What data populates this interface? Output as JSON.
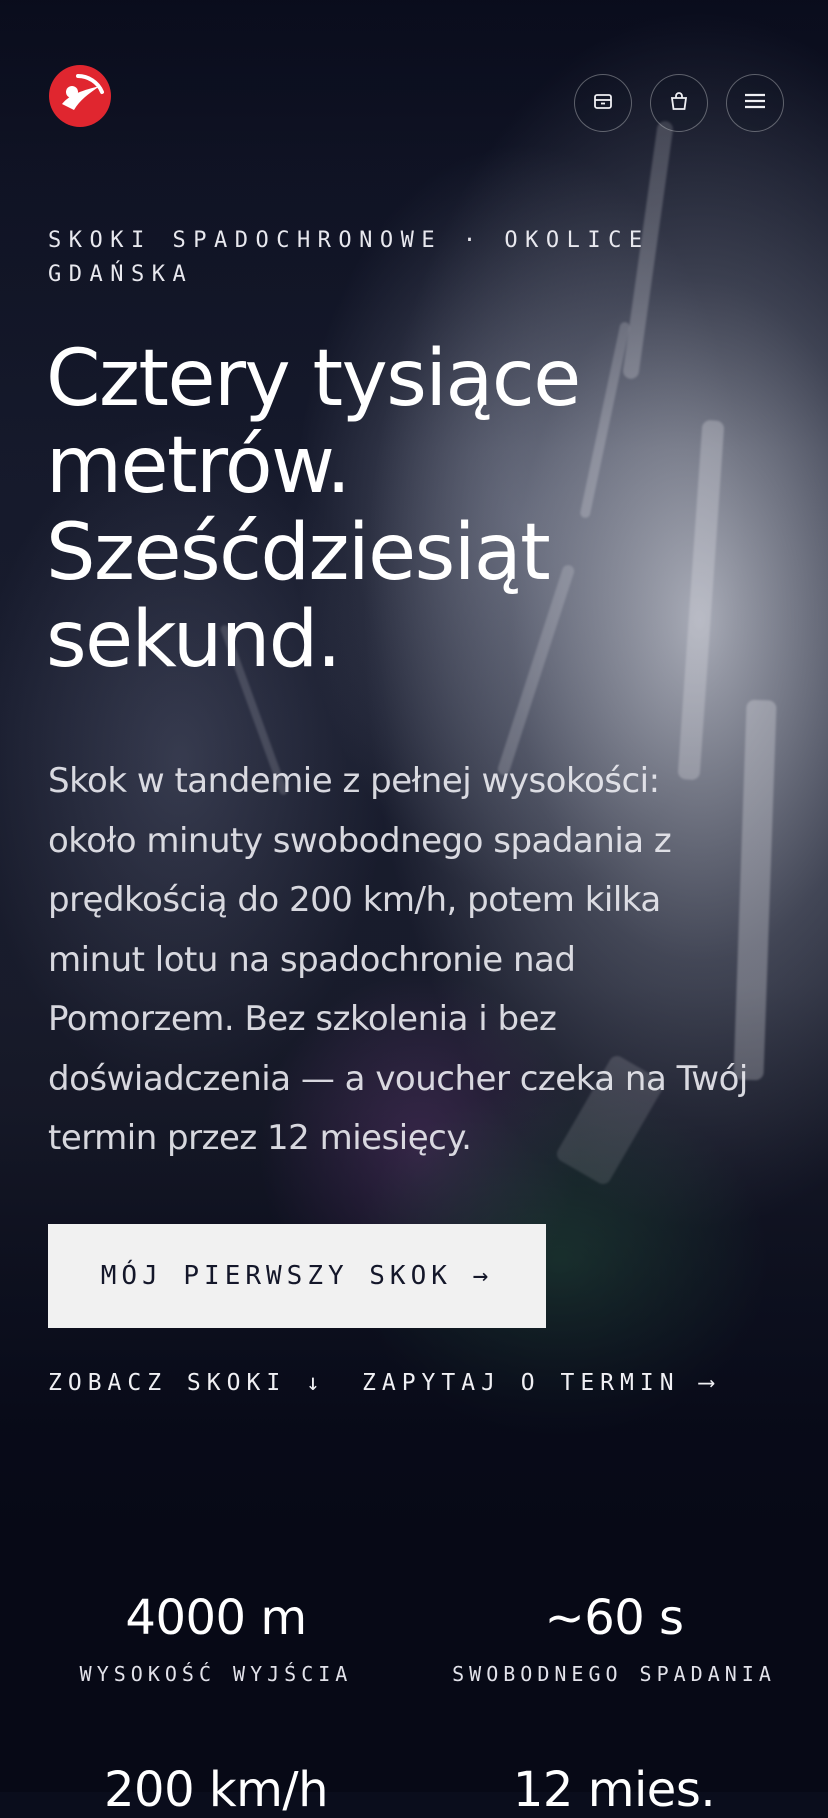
{
  "header": {
    "logo_icon": "skydiver-logo-icon",
    "brand_color": "#e0262f",
    "buttons": [
      {
        "icon": "archive-box-icon"
      },
      {
        "icon": "shopping-bag-icon"
      },
      {
        "icon": "menu-icon"
      }
    ]
  },
  "hero": {
    "eyebrow": "SKOKI SPADOCHRONOWE · OKOLICE GDAŃSKA",
    "headline": "Cztery tysiące metrów. Sześćdziesiąt sekund.",
    "lead": "Skok w tandemie z pełnej wysokości: około minuty swobodnego spadania z prędkością do 200 km/h, potem kilka minut lotu na spadochronie nad Pomorzem. Bez szkolenia i bez doświadczenia — a voucher czeka na Twój termin przez 12 miesięcy.",
    "cta_label": "MÓJ PIERWSZY SKOK →",
    "link_see": "ZOBACZ SKOKI ↓",
    "link_ask": "ZAPYTAJ O TERMIN ⟶"
  },
  "stats": [
    {
      "value": "4000 m",
      "label": "WYSOKOŚĆ WYJŚCIA"
    },
    {
      "value": "~60 s",
      "label": "SWOBODNEGO SPADANIA"
    },
    {
      "value": "200 km/h",
      "label": ""
    },
    {
      "value": "12 mies.",
      "label": ""
    }
  ]
}
